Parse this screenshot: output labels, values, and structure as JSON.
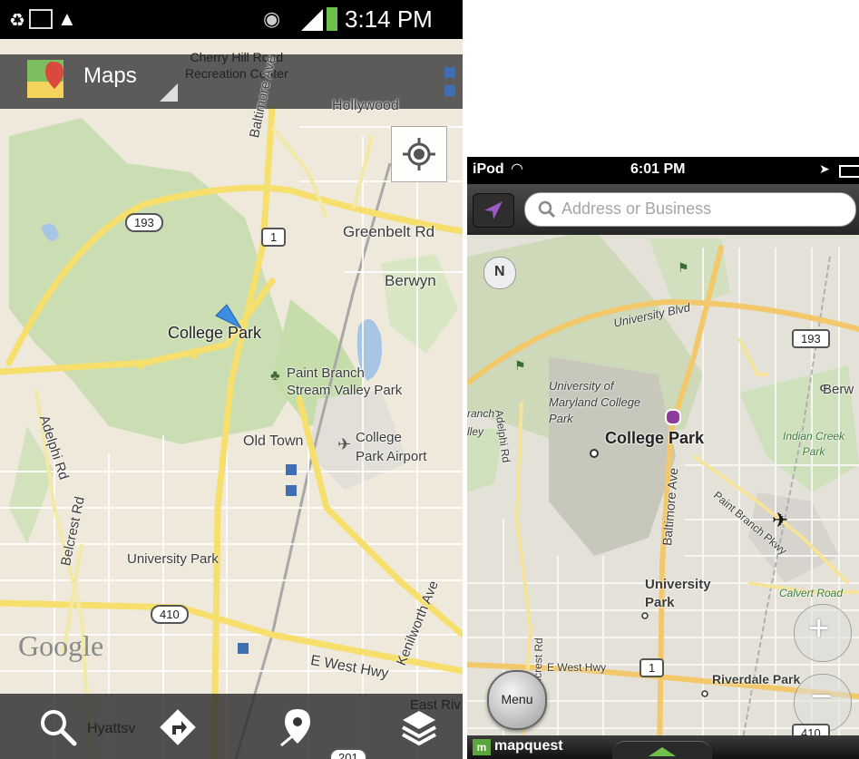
{
  "android": {
    "status": {
      "time": "3:14 PM"
    },
    "app": {
      "name": "Maps"
    },
    "map": {
      "poi_top": "Cherry Hill Road\nRecreation Center",
      "labels": {
        "hollywood": "Hollywood",
        "baltimore_ave": "Baltimore Ave",
        "greenbelt_rd": "Greenbelt Rd",
        "berwyn": "Berwyn",
        "college_park": "College Park",
        "paint_branch": "Paint Branch\nStream Valley Park",
        "old_town": "Old Town",
        "airport": "College\nPark Airport",
        "adelphi_rd": "Adelphi Rd",
        "belcrest_rd": "Belcrest Rd",
        "university_park": "University Park",
        "kenilworth_ave": "Kenilworth Ave",
        "e_west_hwy": "E West Hwy",
        "east_riv": "East Riv",
        "hyattsville": "Hyattsv"
      },
      "shields": {
        "r193": "193",
        "us1": "1",
        "r410": "410",
        "r201": "201"
      },
      "watermark": "Google"
    },
    "toolbar_icons": [
      "search-icon",
      "directions-icon",
      "places-icon",
      "layers-icon"
    ]
  },
  "iphone": {
    "status": {
      "carrier": "iPod",
      "time": "6:01 PM"
    },
    "search": {
      "placeholder": "Address or Business"
    },
    "map": {
      "labels": {
        "university_blvd": "University Blvd",
        "umd": "University of\nMaryland College\nPark",
        "college_park": "College Park",
        "indian_creek": "Indian Creek\nPark",
        "adelphi_rd": "Adelphi Rd",
        "baltimore_ave": "Baltimore Ave",
        "paint_branch": "Paint Branch Pkwy",
        "university_park": "University\nPark",
        "calvert_road": "Calvert Road",
        "belcrest_rd": "Belcrest Rd",
        "e_west_hwy": "E West Hwy",
        "riverdale_park": "Riverdale Park",
        "berw": "Berw",
        "branch": "ranch",
        "lley": "lley"
      },
      "shields": {
        "r193": "193",
        "us1": "1",
        "r410": "410"
      },
      "compass": "N"
    },
    "menu_label": "Menu",
    "brand": "mapquest"
  }
}
